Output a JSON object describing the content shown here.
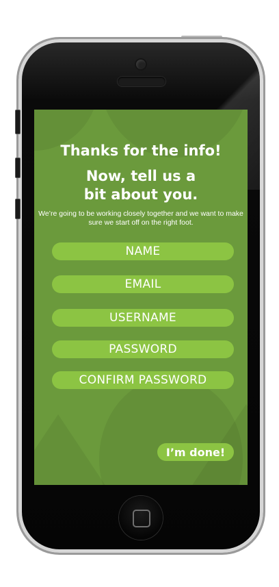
{
  "screen": {
    "heading": "Thanks for the info!",
    "subheading": "Now, tell us a bit about you.",
    "description": "We’re going to be working closely together and we want to make sure we start off on the right foot.",
    "fields": {
      "name_placeholder": "NAME",
      "email_placeholder": "EMAIL",
      "username_placeholder": "USERNAME",
      "password_placeholder": "PASSWORD",
      "confirm_password_placeholder": "CONFIRM PASSWORD"
    },
    "done_label": "I’m done!"
  },
  "colors": {
    "screen_background": "#6b9a3c",
    "field_background": "#8cc443",
    "text": "#ffffff",
    "phone_body": "#050505"
  }
}
